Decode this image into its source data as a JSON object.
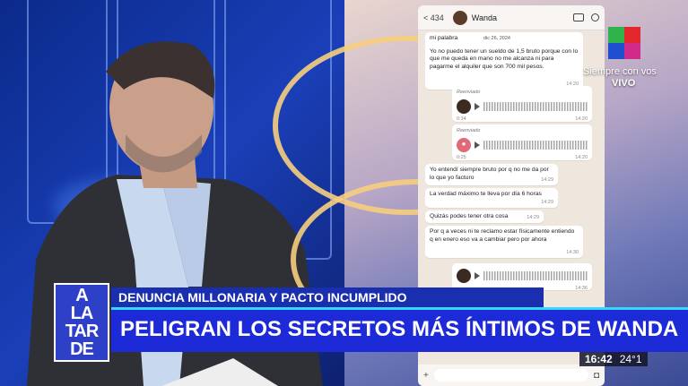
{
  "chat": {
    "contact": "Wanda",
    "back_count": "434",
    "messages": [
      {
        "type": "text",
        "text": "mi palabra",
        "time": ""
      },
      {
        "type": "date",
        "text": "dic 26, 2024"
      },
      {
        "type": "text",
        "text": "Yo no puedo tener un sueldo de 1,5 bruto porque con lo que me queda en mano no me alcanza ni para pagarme el alquiler que son 700 mil pesos.",
        "time": "14:20"
      },
      {
        "type": "audio",
        "label": "Reenviado",
        "duration": "0:34",
        "time": "14:20"
      },
      {
        "type": "audio",
        "label": "Reenviado",
        "duration": "0:25",
        "time": "14:20"
      },
      {
        "type": "text",
        "text": "Yo entendí siempre bruto por q no me da por lo que yo facturo",
        "time": "14:29"
      },
      {
        "type": "text",
        "text": "La verdad máximo te lleva por día 6 horas",
        "time": "14:29"
      },
      {
        "type": "text",
        "text": "Quizás podes tener otra cosa",
        "time": "14:29"
      },
      {
        "type": "text",
        "text": "Por q a veces ni te reclamo estar físicamente entiendo q en enero eso va a cambiar pero por ahora",
        "time": "14:30"
      },
      {
        "type": "audio",
        "label": "",
        "duration": "",
        "time": "14:36"
      }
    ]
  },
  "channel": {
    "tagline": "Siempre con vos",
    "live": "VIVO"
  },
  "lower_third": {
    "logo_lines": [
      "A",
      "LA",
      "TAR",
      "DE"
    ],
    "subtitle": "DENUNCIA MILLONARIA Y PACTO INCUMPLIDO",
    "headline": "PELIGRAN LOS SECRETOS MÁS ÍNTIMOS DE WANDA",
    "time": "16:42",
    "temperature": "24°1"
  },
  "colors": {
    "lower_third_main": "#1d2ad8",
    "lower_third_sub": "#1a2fb0",
    "accent_cyan": "#38d6ff",
    "logo_green": "#2fb34a",
    "logo_red": "#e3262c",
    "logo_blue": "#1f4fd0",
    "logo_magenta": "#d02a8a"
  }
}
